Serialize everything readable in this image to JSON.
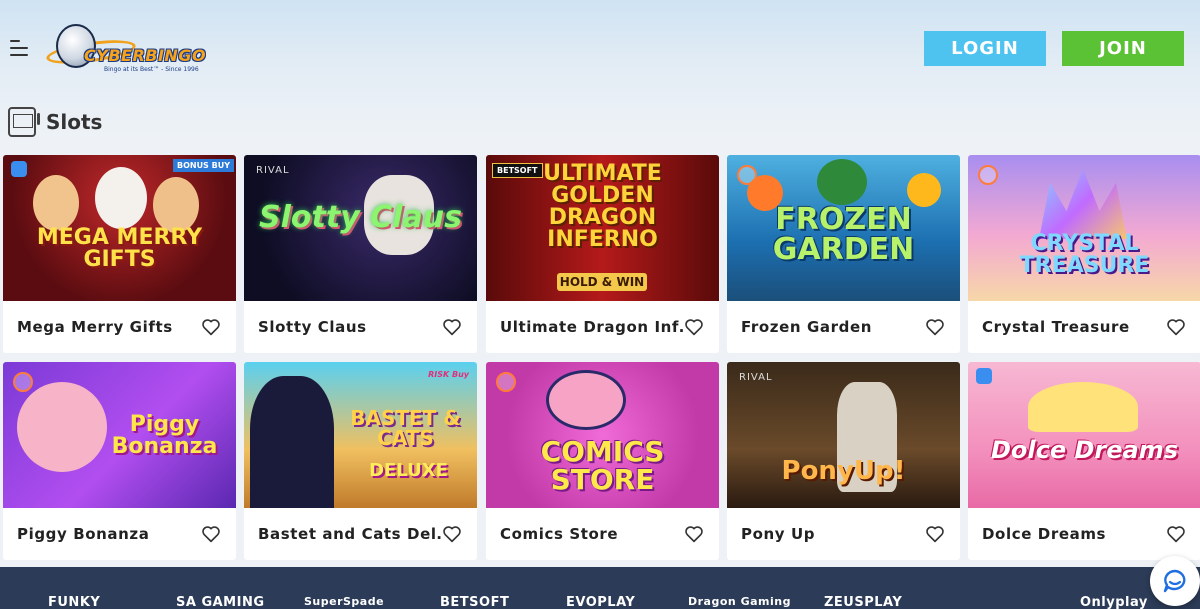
{
  "header": {
    "logo_text": "CYBERBINGO",
    "logo_tagline": "Bingo at its Best™ - Since 1996",
    "login_label": "LOGIN",
    "join_label": "JOIN"
  },
  "section": {
    "title": "Slots",
    "icon": "slot-machine-icon"
  },
  "games": [
    {
      "name": "Mega Merry Gifts",
      "thumb_title": "MEGA MERRY GIFTS",
      "badge": "BONUS BUY"
    },
    {
      "name": "Slotty Claus",
      "thumb_title": "Slotty Claus",
      "provider": "RIVAL"
    },
    {
      "name": "Ultimate Dragon Inf…",
      "thumb_title": "ULTIMATE GOLDEN DRAGON INFERNO",
      "thumb_sub": "HOLD & WIN",
      "provider": "BETSOFT"
    },
    {
      "name": "Frozen Garden",
      "thumb_title": "FROZEN GARDEN"
    },
    {
      "name": "Crystal Treasure",
      "thumb_title": "CRYSTAL TREASURE"
    },
    {
      "name": "Piggy Bonanza",
      "thumb_title": "Piggy Bonanza"
    },
    {
      "name": "Bastet and Cats Del…",
      "thumb_title": "BASTET & CATS",
      "thumb_sub": "DELUXE",
      "badge": "RISK Buy"
    },
    {
      "name": "Comics Store",
      "thumb_title": "COMICS STORE"
    },
    {
      "name": "Pony Up",
      "thumb_title": "PonyUp!",
      "provider": "RIVAL"
    },
    {
      "name": "Dolce Dreams",
      "thumb_title": "Dolce Dreams"
    }
  ],
  "footer_providers": [
    "FUNKY",
    "SA GAMING",
    "SuperSpade",
    "BETSOFT",
    "EVOPLAY",
    "Dragon Gaming",
    "ZEUSPLAY",
    "Onlyplay"
  ],
  "colors": {
    "login": "#4fc3ef",
    "join": "#5bc236",
    "footer": "#2c3b57"
  }
}
